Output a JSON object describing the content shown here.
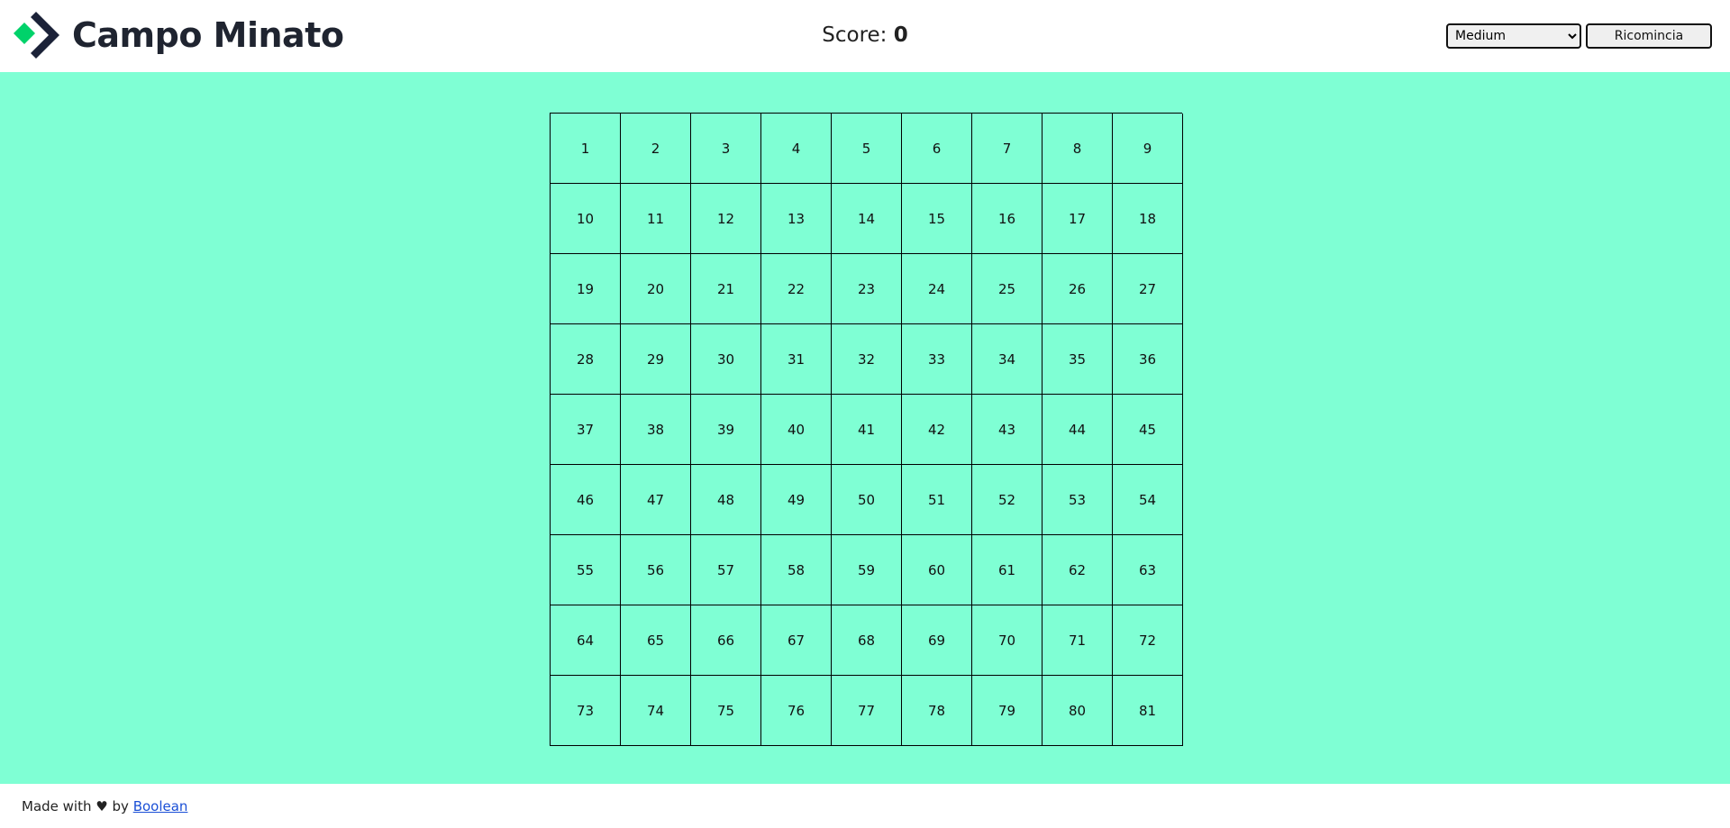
{
  "header": {
    "title": "Campo Minato",
    "score_label": "Score:",
    "score_value": "0",
    "difficulty_selected": "Medium",
    "restart_label": "Ricomincia",
    "logo_colors": {
      "green": "#00d26a",
      "navy": "#1b2238"
    }
  },
  "board": {
    "rows": 9,
    "cols": 9,
    "cells": [
      "1",
      "2",
      "3",
      "4",
      "5",
      "6",
      "7",
      "8",
      "9",
      "10",
      "11",
      "12",
      "13",
      "14",
      "15",
      "16",
      "17",
      "18",
      "19",
      "20",
      "21",
      "22",
      "23",
      "24",
      "25",
      "26",
      "27",
      "28",
      "29",
      "30",
      "31",
      "32",
      "33",
      "34",
      "35",
      "36",
      "37",
      "38",
      "39",
      "40",
      "41",
      "42",
      "43",
      "44",
      "45",
      "46",
      "47",
      "48",
      "49",
      "50",
      "51",
      "52",
      "53",
      "54",
      "55",
      "56",
      "57",
      "58",
      "59",
      "60",
      "61",
      "62",
      "63",
      "64",
      "65",
      "66",
      "67",
      "68",
      "69",
      "70",
      "71",
      "72",
      "73",
      "74",
      "75",
      "76",
      "77",
      "78",
      "79",
      "80",
      "81"
    ],
    "background_color": "#7fffd4"
  },
  "footer": {
    "prefix": "Made with",
    "heart": "♥",
    "by": "by",
    "link_label": "Boolean"
  }
}
